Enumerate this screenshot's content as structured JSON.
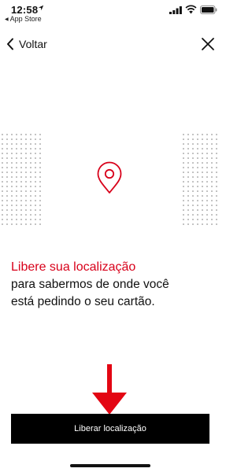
{
  "status_bar": {
    "time": "12:58",
    "back_to_app": "App Store"
  },
  "nav": {
    "back_label": "Voltar"
  },
  "content": {
    "headline": "Libere sua localização",
    "line1": "para sabermos de onde você",
    "line2": "está pedindo o seu cartão."
  },
  "cta": {
    "label": "Liberar localização"
  },
  "colors": {
    "accent": "#d8001a",
    "button_bg": "#000000",
    "annotation_arrow": "#e30613"
  },
  "icons": [
    "location-arrow-icon",
    "signal-icon",
    "wifi-icon",
    "battery-icon",
    "chevron-left-icon",
    "close-icon",
    "location-pin-icon"
  ]
}
